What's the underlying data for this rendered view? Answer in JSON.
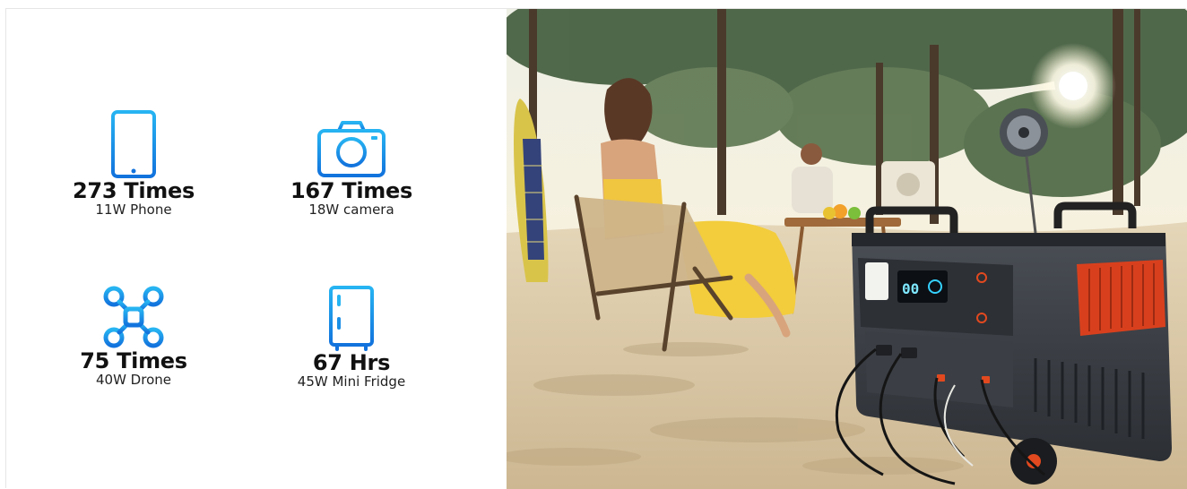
{
  "specs": [
    {
      "icon": "phone-icon",
      "value": "273 Times",
      "label": "11W Phone"
    },
    {
      "icon": "camera-icon",
      "value": "167 Times",
      "label": "18W camera"
    },
    {
      "icon": "drone-icon",
      "value": "75 Times",
      "label": "40W Drone"
    },
    {
      "icon": "fridge-icon",
      "value": "67 Hrs",
      "label": "45W Mini Fridge"
    }
  ],
  "colors": {
    "icon_top": "#27b4f2",
    "icon_bottom": "#1273dd",
    "accent_orange": "#e2491f",
    "station_body": "#3a3d42"
  },
  "photo": {
    "display_digits": "00"
  }
}
